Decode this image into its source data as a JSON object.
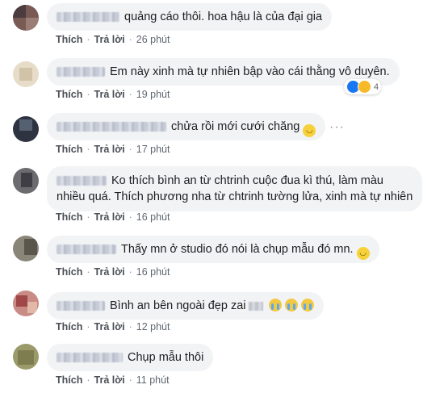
{
  "actions": {
    "like": "Thích",
    "reply": "Trả lời",
    "sep": "·"
  },
  "comments": [
    {
      "text": "quảng cáo thôi. hoa hậu là của đại gia",
      "time": "26 phút"
    },
    {
      "text": "Em này xinh mà tự nhiên bập vào cái thằng vô duyên.",
      "time": "19 phút",
      "reaction_count": "4"
    },
    {
      "text": "chửa rồi mới cưới chăng",
      "time": "17 phút",
      "emoji": "smile-emoji"
    },
    {
      "text_line1": "Ko thích bình an từ chtrinh cuộc đua kì thú, làm màu",
      "text_line2": "nhiều quá. Thích phương nha từ chtrinh tường lửa, xinh mà tự nhiên",
      "time": "16 phút"
    },
    {
      "text": "Thấy mn ở studio đó nói là chụp mẫu đó mn.",
      "time": "16 phút",
      "emoji": "smile-emoji"
    },
    {
      "text": "Bình an bên ngoài đẹp zai",
      "time": "12 phút",
      "emoji": "crying-emoji"
    },
    {
      "text": "Chụp mẫu thôi",
      "time": "11 phút"
    }
  ],
  "colors": {
    "bubble": "#f2f3f5",
    "link": "#4b4f56",
    "meta": "#606770",
    "like": "#1877f2"
  }
}
